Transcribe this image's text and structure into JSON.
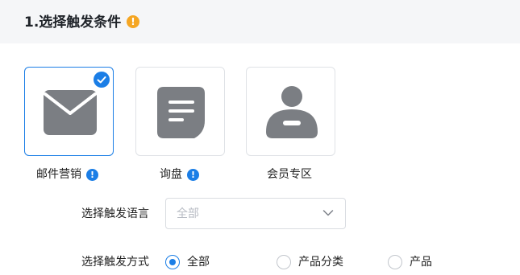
{
  "section": {
    "title": "1.选择触发条件",
    "info_icon": "exclamation-icon",
    "accent_color": "#f5a623"
  },
  "trigger_cards": [
    {
      "label": "邮件营销",
      "icon": "mail-icon",
      "selected": true,
      "has_info": true
    },
    {
      "label": "询盘",
      "icon": "message-icon",
      "selected": false,
      "has_info": true
    },
    {
      "label": "会员专区",
      "icon": "user-icon",
      "selected": false,
      "has_info": false
    }
  ],
  "language": {
    "label": "选择触发语言",
    "value": "全部",
    "dropdown_icon": "chevron-down-icon"
  },
  "method": {
    "label": "选择触发方式",
    "options": [
      {
        "label": "全部",
        "selected": true
      },
      {
        "label": "产品分类",
        "selected": false
      },
      {
        "label": "产品",
        "selected": false
      }
    ]
  },
  "colors": {
    "primary": "#1b7ee6",
    "icon_gray": "#7b7e83"
  }
}
